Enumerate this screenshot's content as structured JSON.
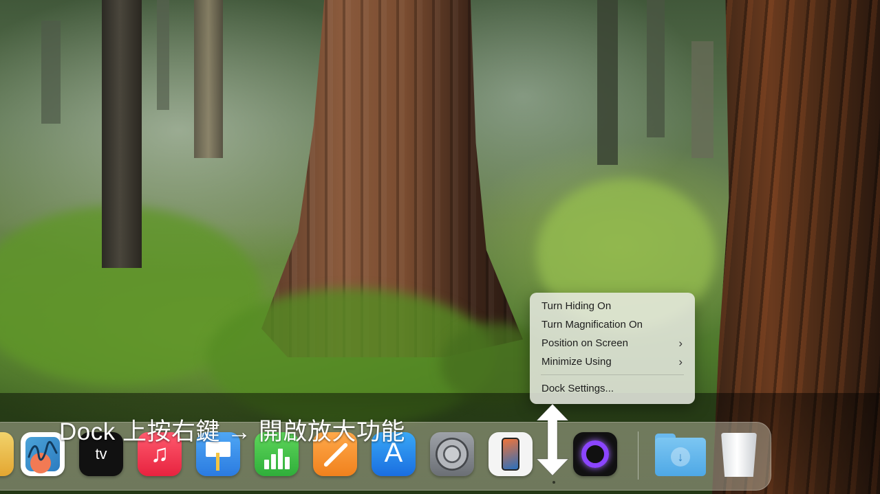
{
  "context_menu": {
    "items": [
      {
        "label": "Turn Hiding On",
        "submenu": false
      },
      {
        "label": "Turn Magnification On",
        "submenu": false
      },
      {
        "label": "Position on Screen",
        "submenu": true
      },
      {
        "label": "Minimize Using",
        "submenu": true
      }
    ],
    "settings_label": "Dock Settings...",
    "submenu_glyph": "›"
  },
  "caption": "Dock 上按右鍵 → 開啟放大功能",
  "dock": {
    "icons": [
      {
        "name": "app-partial-icon"
      },
      {
        "name": "freeform-app-icon"
      },
      {
        "name": "apple-tv-app-icon",
        "glyph": "tv"
      },
      {
        "name": "music-app-icon",
        "glyph": "♫"
      },
      {
        "name": "keynote-app-icon"
      },
      {
        "name": "numbers-app-icon"
      },
      {
        "name": "pages-app-icon"
      },
      {
        "name": "app-store-icon",
        "glyph": "A"
      },
      {
        "name": "system-settings-icon"
      },
      {
        "name": "iphone-mirroring-icon"
      },
      {
        "name": "mirror-app-icon"
      },
      {
        "name": "downloads-folder-icon",
        "glyph": "↓"
      },
      {
        "name": "trash-icon"
      }
    ]
  },
  "annotation": {
    "arrow": "up-down-arrow-icon",
    "color": "#ffffff"
  }
}
